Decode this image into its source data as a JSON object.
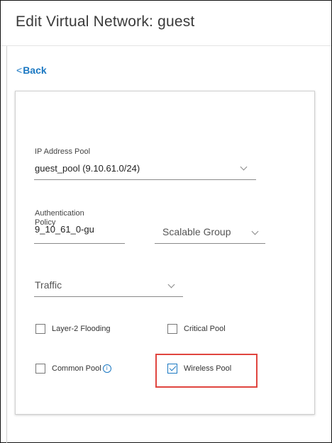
{
  "header": {
    "title": "Edit Virtual Network: guest"
  },
  "nav": {
    "back_label": "Back",
    "back_chevron": "<"
  },
  "form": {
    "ip_pool": {
      "label": "IP Address Pool",
      "value": "guest_pool (9.10.61.0/24)"
    },
    "auth_policy": {
      "label_line1": "Authentication",
      "label_line2": "Policy",
      "value": "9_10_61_0-gu"
    },
    "scalable_group": {
      "placeholder": "Scalable Group"
    },
    "traffic": {
      "placeholder": "Traffic"
    },
    "checkboxes": {
      "layer2_flooding": {
        "label": "Layer-2 Flooding",
        "checked": false
      },
      "critical_pool": {
        "label": "Critical Pool",
        "checked": false
      },
      "common_pool": {
        "label": "Common Pool",
        "checked": false,
        "info_icon": "i"
      },
      "wireless_pool": {
        "label": "Wireless Pool",
        "checked": true
      }
    }
  },
  "colors": {
    "accent": "#1b78c2",
    "highlight": "#e0453f"
  }
}
